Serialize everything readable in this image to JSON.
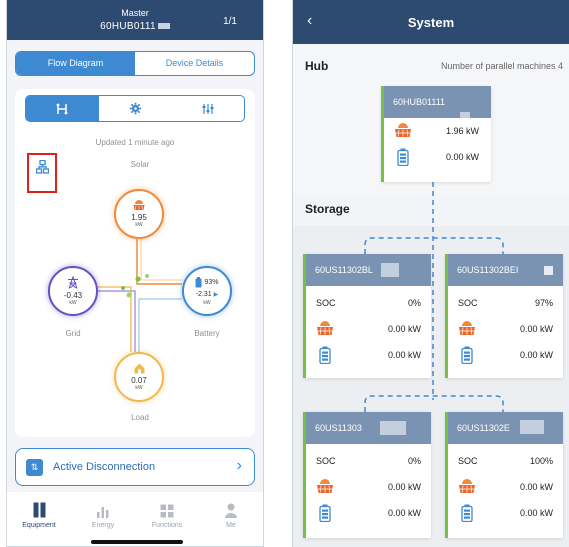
{
  "left": {
    "header": {
      "role": "Master",
      "device_id": "60HUB0111",
      "page": "1/1"
    },
    "segment": [
      "Flow Diagram",
      "Device Details"
    ],
    "updated": "Updated 1 minute ago",
    "icon_tabs": [
      "flow-icon",
      "gear-icon",
      "sliders-icon"
    ],
    "nodes": {
      "solar": {
        "label": "Solar",
        "value": "1.95",
        "unit": "kW"
      },
      "grid": {
        "label": "Grid",
        "value": "-0.43",
        "unit": "kW"
      },
      "battery": {
        "label": "Battery",
        "percent": "93%",
        "value": "-2.31",
        "unit": "kW"
      },
      "load": {
        "label": "Load",
        "value": "0.07",
        "unit": "kW"
      }
    },
    "action": {
      "label": "Active Disconnection"
    },
    "tabs": [
      "Equipment",
      "Energy",
      "Functions",
      "Me"
    ],
    "colors": {
      "header": "#2d4a70",
      "accent": "#3d8ad2",
      "highlight_box": "#e0201b"
    }
  },
  "right": {
    "header": {
      "back": "‹",
      "title": "System"
    },
    "hub_section": {
      "title": "Hub",
      "parallel_label": "Number of parallel machines 4"
    },
    "hub": {
      "name": "60HUB01111",
      "solar": "1.96 kW",
      "battery": "0.00 kW"
    },
    "storage_section": {
      "title": "Storage"
    },
    "storage": [
      {
        "name": "60US11302BL",
        "soc_label": "SOC",
        "soc": "0%",
        "solar": "0.00 kW",
        "battery": "0.00 kW"
      },
      {
        "name": "60US11302BEI",
        "soc_label": "SOC",
        "soc": "97%",
        "solar": "0.00 kW",
        "battery": "0.00 kW"
      },
      {
        "name": "60US11303",
        "soc_label": "SOC",
        "soc": "0%",
        "solar": "0.00 kW",
        "battery": "0.00 kW"
      },
      {
        "name": "60US11302E",
        "soc_label": "SOC",
        "soc": "100%",
        "solar": "0.00 kW",
        "battery": "0.00 kW"
      }
    ],
    "colors": {
      "card_header": "#7a93b2",
      "status_bar": "#76c043",
      "connector": "#3d8ad2"
    }
  }
}
